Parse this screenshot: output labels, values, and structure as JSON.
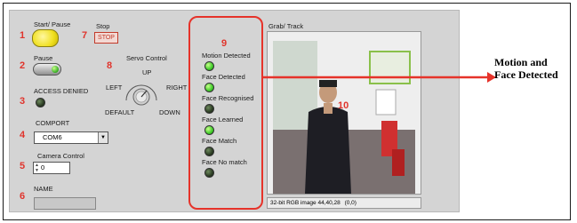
{
  "controls": {
    "start_pause": {
      "label": "Start/ Pause",
      "number": "1"
    },
    "stop": {
      "label": "Stop",
      "button_text": "STOP",
      "number": "7"
    },
    "pause": {
      "label": "Pause",
      "number": "2"
    },
    "access": {
      "label": "ACCESS DENIED",
      "number": "3"
    },
    "comport": {
      "label": "COMPORT",
      "value": "COM6",
      "number": "4"
    },
    "camera_control": {
      "label": "Camera Control",
      "value": "0",
      "number": "5"
    },
    "name": {
      "label": "NAME",
      "value": "",
      "number": "6"
    }
  },
  "servo": {
    "title": "Servo Control",
    "number": "8",
    "up": "UP",
    "left": "LEFT",
    "right": "RIGHT",
    "default": "DEFAULT",
    "down": "DOWN"
  },
  "indicators": {
    "number": "9",
    "items": [
      {
        "label": "Motion Detected",
        "state": "on"
      },
      {
        "label": "Face Detected",
        "state": "on"
      },
      {
        "label": "Face Recognised",
        "state": "off"
      },
      {
        "label": "Face Learned",
        "state": "on"
      },
      {
        "label": "Face Match",
        "state": "off"
      },
      {
        "label": "Face No match",
        "state": "off"
      }
    ]
  },
  "display": {
    "title": "Grab/ Track",
    "number": "10",
    "status": "32-bit RGB image 44,40,28",
    "coords": "(0,0)"
  },
  "annotation": {
    "line1": "Motion and",
    "line2": "Face Detected",
    "color": "#e6332a"
  },
  "colors": {
    "panel": "#d4d4d4",
    "led_on": "#3fcc2a",
    "led_off": "#2c3d24",
    "label_red": "#e0342c"
  }
}
